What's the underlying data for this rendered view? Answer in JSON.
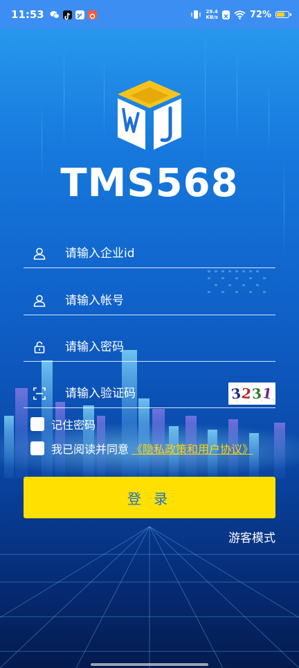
{
  "status_bar": {
    "time": "11:53",
    "net_speed_value": "29.4",
    "net_speed_unit": "KB/s",
    "battery_text": "72%",
    "battery_level": 0.72,
    "battery_color": "#ffd21f",
    "left_icons": [
      "wechat-icon",
      "tiktok-icon",
      "app-icon",
      "notification-app-icon"
    ],
    "right_icons": [
      "vibrate-icon",
      "network-speed-icon",
      "sim-off-icon",
      "wifi-icon",
      "battery-icon"
    ]
  },
  "brand": {
    "title": "TMS568",
    "logo_icon": "tms-cube-logo-icon",
    "logo_colors": {
      "top": "#f7c31b",
      "side": "#ffffff"
    }
  },
  "form": {
    "company_id": {
      "placeholder": "请输入企业id",
      "value": "",
      "icon": "user-icon"
    },
    "account": {
      "placeholder": "请输入帐号",
      "value": "",
      "icon": "user-icon"
    },
    "password": {
      "placeholder": "请输入密码",
      "value": "",
      "icon": "lock-icon"
    },
    "captcha": {
      "placeholder": "请输入验证码",
      "value": "",
      "icon": "scan-icon",
      "image_text": "3231"
    }
  },
  "options": {
    "remember_password": {
      "label": "记住密码",
      "checked": false
    },
    "agreement": {
      "label": "我已阅读并同意",
      "link_text": "《隐私政策和用户协议》",
      "checked": false
    }
  },
  "actions": {
    "login_label": "登 录",
    "guest_label": "游客模式"
  },
  "theme": {
    "accent_yellow": "#ffe000",
    "link_yellow": "#ffd400",
    "button_text_blue": "#1b6fd0",
    "bg_top": "#2a9ff0",
    "bg_bottom": "#041b4e"
  }
}
